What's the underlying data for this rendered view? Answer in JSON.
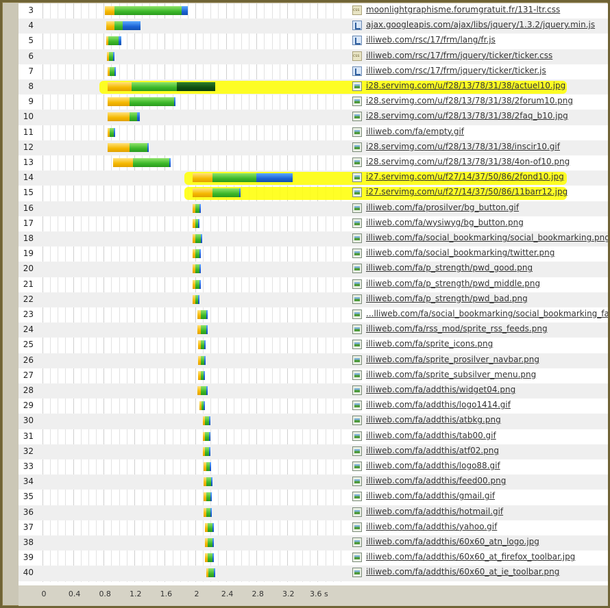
{
  "rows": [
    {
      "num": "3",
      "type": "css",
      "url": "moonlightgraphisme.forumgratuit.fr/131-ltr.css",
      "timing": [
        {
          "k": "wait",
          "s": 0.82,
          "e": 0.94
        },
        {
          "k": "recv",
          "s": 0.94,
          "e": 1.82
        },
        {
          "k": "cont",
          "s": 1.82,
          "e": 1.9
        }
      ]
    },
    {
      "num": "4",
      "type": "script",
      "url": "ajax.googleapis.com/ajax/libs/jquery/1.3.2/jquery.min.js",
      "timing": [
        {
          "k": "wait",
          "s": 0.83,
          "e": 0.94
        },
        {
          "k": "recv",
          "s": 0.94,
          "e": 1.05
        },
        {
          "k": "cont",
          "s": 1.05,
          "e": 1.28
        }
      ]
    },
    {
      "num": "5",
      "type": "script",
      "url": "illiweb.com/rsc/17/frm/lang/fr.js",
      "timing": [
        {
          "k": "wait",
          "s": 0.83,
          "e": 0.86
        },
        {
          "k": "recv",
          "s": 0.86,
          "e": 1.0
        },
        {
          "k": "cont",
          "s": 1.0,
          "e": 1.03
        }
      ]
    },
    {
      "num": "6",
      "type": "css",
      "url": "illiweb.com/rsc/17/frm/jquery/ticker/ticker.css",
      "timing": [
        {
          "k": "wait",
          "s": 0.84,
          "e": 0.87
        },
        {
          "k": "recv",
          "s": 0.87,
          "e": 0.92
        },
        {
          "k": "cont",
          "s": 0.92,
          "e": 0.93
        }
      ]
    },
    {
      "num": "7",
      "type": "script",
      "url": "illiweb.com/rsc/17/frm/jquery/ticker/ticker.js",
      "timing": [
        {
          "k": "wait",
          "s": 0.85,
          "e": 0.88
        },
        {
          "k": "recv",
          "s": 0.88,
          "e": 0.94
        },
        {
          "k": "cont",
          "s": 0.94,
          "e": 0.95
        }
      ]
    },
    {
      "num": "8",
      "type": "image",
      "url": "i28.servimg.com/u/f28/13/78/31/38/actuel10.jpg",
      "highlight": true,
      "timing": [
        {
          "k": "wait",
          "s": 0.85,
          "e": 1.17
        },
        {
          "k": "recv",
          "s": 1.17,
          "e": 1.76
        },
        {
          "k": "dark",
          "s": 1.76,
          "e": 2.26
        }
      ]
    },
    {
      "num": "9",
      "type": "image",
      "url": "i28.servimg.com/u/f28/13/78/31/38/2forum10.png",
      "timing": [
        {
          "k": "wait",
          "s": 0.85,
          "e": 1.14
        },
        {
          "k": "recv",
          "s": 1.14,
          "e": 1.72
        },
        {
          "k": "cont",
          "s": 1.72,
          "e": 1.74
        }
      ]
    },
    {
      "num": "10",
      "type": "image",
      "url": "i28.servimg.com/u/f28/13/78/31/38/2faq_b10.jpg",
      "timing": [
        {
          "k": "wait",
          "s": 0.85,
          "e": 1.14
        },
        {
          "k": "recv",
          "s": 1.14,
          "e": 1.24
        },
        {
          "k": "cont",
          "s": 1.24,
          "e": 1.27
        }
      ]
    },
    {
      "num": "11",
      "type": "image",
      "url": "illiweb.com/fa/empty.gif",
      "timing": [
        {
          "k": "wait",
          "s": 0.85,
          "e": 0.88
        },
        {
          "k": "recv",
          "s": 0.88,
          "e": 0.93
        },
        {
          "k": "cont",
          "s": 0.93,
          "e": 0.94
        }
      ]
    },
    {
      "num": "12",
      "type": "image",
      "url": "i28.servimg.com/u/f28/13/78/31/38/inscir10.gif",
      "timing": [
        {
          "k": "wait",
          "s": 0.85,
          "e": 1.14
        },
        {
          "k": "recv",
          "s": 1.14,
          "e": 1.37
        },
        {
          "k": "cont",
          "s": 1.37,
          "e": 1.39
        }
      ]
    },
    {
      "num": "13",
      "type": "image",
      "url": "i28.servimg.com/u/f28/13/78/31/38/4on-of10.png",
      "timing": [
        {
          "k": "wait",
          "s": 0.92,
          "e": 1.18
        },
        {
          "k": "recv",
          "s": 1.18,
          "e": 1.66
        },
        {
          "k": "cont",
          "s": 1.66,
          "e": 1.68
        }
      ]
    },
    {
      "num": "14",
      "type": "image",
      "url": "i27.servimg.com/u/f27/14/37/50/86/2fond10.jpg",
      "highlight": true,
      "timing": [
        {
          "k": "wait",
          "s": 1.96,
          "e": 2.22
        },
        {
          "k": "recv",
          "s": 2.22,
          "e": 2.8
        },
        {
          "k": "cont",
          "s": 2.8,
          "e": 3.27
        }
      ]
    },
    {
      "num": "15",
      "type": "image",
      "url": "i27.servimg.com/u/f27/14/37/50/86/11barr12.jpg",
      "highlight": true,
      "timing": [
        {
          "k": "wait",
          "s": 1.96,
          "e": 2.22
        },
        {
          "k": "recv",
          "s": 2.22,
          "e": 2.57
        },
        {
          "k": "cont",
          "s": 2.57,
          "e": 2.59
        }
      ]
    },
    {
      "num": "16",
      "type": "image",
      "url": "illiweb.com/fa/prosilver/bg_button.gif",
      "timing": [
        {
          "k": "wait",
          "s": 1.96,
          "e": 2.0
        },
        {
          "k": "recv",
          "s": 2.0,
          "e": 2.05
        },
        {
          "k": "cont",
          "s": 2.05,
          "e": 2.06
        }
      ]
    },
    {
      "num": "17",
      "type": "image",
      "url": "illiweb.com/fa/wysiwyg/bg_button.png",
      "timing": [
        {
          "k": "wait",
          "s": 1.96,
          "e": 2.0
        },
        {
          "k": "recv",
          "s": 2.0,
          "e": 2.04
        },
        {
          "k": "cont",
          "s": 2.04,
          "e": 2.05
        }
      ]
    },
    {
      "num": "18",
      "type": "image",
      "url": "illiweb.com/fa/social_bookmarking/social_bookmarking.png",
      "timing": [
        {
          "k": "wait",
          "s": 1.96,
          "e": 2.0
        },
        {
          "k": "recv",
          "s": 2.0,
          "e": 2.07
        },
        {
          "k": "cont",
          "s": 2.07,
          "e": 2.08
        }
      ]
    },
    {
      "num": "19",
      "type": "image",
      "url": "illiweb.com/fa/social_bookmarking/twitter.png",
      "timing": [
        {
          "k": "wait",
          "s": 1.96,
          "e": 2.0
        },
        {
          "k": "recv",
          "s": 2.0,
          "e": 2.05
        },
        {
          "k": "cont",
          "s": 2.05,
          "e": 2.06
        }
      ]
    },
    {
      "num": "20",
      "type": "image",
      "url": "illiweb.com/fa/p_strength/pwd_good.png",
      "timing": [
        {
          "k": "wait",
          "s": 1.96,
          "e": 2.0
        },
        {
          "k": "recv",
          "s": 2.0,
          "e": 2.05
        },
        {
          "k": "cont",
          "s": 2.05,
          "e": 2.06
        }
      ]
    },
    {
      "num": "21",
      "type": "image",
      "url": "illiweb.com/fa/p_strength/pwd_middle.png",
      "timing": [
        {
          "k": "wait",
          "s": 1.96,
          "e": 2.0
        },
        {
          "k": "recv",
          "s": 2.0,
          "e": 2.05
        },
        {
          "k": "cont",
          "s": 2.05,
          "e": 2.06
        }
      ]
    },
    {
      "num": "22",
      "type": "image",
      "url": "illiweb.com/fa/p_strength/pwd_bad.png",
      "timing": [
        {
          "k": "wait",
          "s": 1.96,
          "e": 2.0
        },
        {
          "k": "recv",
          "s": 2.0,
          "e": 2.04
        },
        {
          "k": "cont",
          "s": 2.04,
          "e": 2.05
        }
      ]
    },
    {
      "num": "23",
      "type": "image",
      "url": "...lliweb.com/fa/social_bookmarking/social_bookmarking_fa.png",
      "timing": [
        {
          "k": "wait",
          "s": 2.03,
          "e": 2.07
        },
        {
          "k": "recv",
          "s": 2.07,
          "e": 2.14
        },
        {
          "k": "cont",
          "s": 2.14,
          "e": 2.15
        }
      ]
    },
    {
      "num": "24",
      "type": "image",
      "url": "illiweb.com/fa/rss_mod/sprite_rss_feeds.png",
      "timing": [
        {
          "k": "wait",
          "s": 2.03,
          "e": 2.07
        },
        {
          "k": "recv",
          "s": 2.07,
          "e": 2.14
        },
        {
          "k": "cont",
          "s": 2.14,
          "e": 2.15
        }
      ]
    },
    {
      "num": "25",
      "type": "image",
      "url": "illiweb.com/fa/sprite_icons.png",
      "timing": [
        {
          "k": "wait",
          "s": 2.04,
          "e": 2.07
        },
        {
          "k": "recv",
          "s": 2.07,
          "e": 2.12
        },
        {
          "k": "cont",
          "s": 2.12,
          "e": 2.13
        }
      ]
    },
    {
      "num": "26",
      "type": "image",
      "url": "illiweb.com/fa/sprite_prosilver_navbar.png",
      "timing": [
        {
          "k": "wait",
          "s": 2.04,
          "e": 2.07
        },
        {
          "k": "recv",
          "s": 2.07,
          "e": 2.12
        },
        {
          "k": "cont",
          "s": 2.12,
          "e": 2.13
        }
      ]
    },
    {
      "num": "27",
      "type": "image",
      "url": "illiweb.com/fa/sprite_subsilver_menu.png",
      "timing": [
        {
          "k": "wait",
          "s": 2.04,
          "e": 2.07
        },
        {
          "k": "recv",
          "s": 2.07,
          "e": 2.11
        },
        {
          "k": "cont",
          "s": 2.11,
          "e": 2.12
        }
      ]
    },
    {
      "num": "28",
      "type": "image",
      "url": "illiweb.com/fa/addthis/widget04.png",
      "timing": [
        {
          "k": "wait",
          "s": 2.03,
          "e": 2.07
        },
        {
          "k": "recv",
          "s": 2.07,
          "e": 2.14
        },
        {
          "k": "cont",
          "s": 2.14,
          "e": 2.15
        }
      ]
    },
    {
      "num": "29",
      "type": "image",
      "url": "illiweb.com/fa/addthis/logo1414.gif",
      "timing": [
        {
          "k": "wait",
          "s": 2.05,
          "e": 2.08
        },
        {
          "k": "recv",
          "s": 2.08,
          "e": 2.11
        },
        {
          "k": "cont",
          "s": 2.11,
          "e": 2.12
        }
      ]
    },
    {
      "num": "30",
      "type": "image",
      "url": "illiweb.com/fa/addthis/atbkg.png",
      "timing": [
        {
          "k": "wait",
          "s": 2.1,
          "e": 2.13
        },
        {
          "k": "recv",
          "s": 2.13,
          "e": 2.18
        },
        {
          "k": "cont",
          "s": 2.18,
          "e": 2.19
        }
      ]
    },
    {
      "num": "31",
      "type": "image",
      "url": "illiweb.com/fa/addthis/tab00.gif",
      "timing": [
        {
          "k": "wait",
          "s": 2.1,
          "e": 2.13
        },
        {
          "k": "recv",
          "s": 2.13,
          "e": 2.18
        },
        {
          "k": "cont",
          "s": 2.18,
          "e": 2.19
        }
      ]
    },
    {
      "num": "32",
      "type": "image",
      "url": "illiweb.com/fa/addthis/atf02.png",
      "timing": [
        {
          "k": "wait",
          "s": 2.1,
          "e": 2.13
        },
        {
          "k": "recv",
          "s": 2.13,
          "e": 2.18
        },
        {
          "k": "cont",
          "s": 2.18,
          "e": 2.19
        }
      ]
    },
    {
      "num": "33",
      "type": "image",
      "url": "illiweb.com/fa/addthis/logo88.gif",
      "timing": [
        {
          "k": "wait",
          "s": 2.11,
          "e": 2.14
        },
        {
          "k": "recv",
          "s": 2.14,
          "e": 2.19
        },
        {
          "k": "cont",
          "s": 2.19,
          "e": 2.2
        }
      ]
    },
    {
      "num": "34",
      "type": "image",
      "url": "illiweb.com/fa/addthis/feed00.png",
      "timing": [
        {
          "k": "wait",
          "s": 2.11,
          "e": 2.14
        },
        {
          "k": "recv",
          "s": 2.14,
          "e": 2.21
        },
        {
          "k": "cont",
          "s": 2.21,
          "e": 2.22
        }
      ]
    },
    {
      "num": "35",
      "type": "image",
      "url": "illiweb.com/fa/addthis/gmail.gif",
      "timing": [
        {
          "k": "wait",
          "s": 2.11,
          "e": 2.14
        },
        {
          "k": "recv",
          "s": 2.14,
          "e": 2.2
        },
        {
          "k": "cont",
          "s": 2.2,
          "e": 2.21
        }
      ]
    },
    {
      "num": "36",
      "type": "image",
      "url": "illiweb.com/fa/addthis/hotmail.gif",
      "timing": [
        {
          "k": "wait",
          "s": 2.11,
          "e": 2.14
        },
        {
          "k": "recv",
          "s": 2.14,
          "e": 2.2
        },
        {
          "k": "cont",
          "s": 2.2,
          "e": 2.21
        }
      ]
    },
    {
      "num": "37",
      "type": "image",
      "url": "illiweb.com/fa/addthis/yahoo.gif",
      "timing": [
        {
          "k": "wait",
          "s": 2.13,
          "e": 2.16
        },
        {
          "k": "recv",
          "s": 2.16,
          "e": 2.22
        },
        {
          "k": "cont",
          "s": 2.22,
          "e": 2.23
        }
      ]
    },
    {
      "num": "38",
      "type": "image",
      "url": "illiweb.com/fa/addthis/60x60_atn_logo.jpg",
      "timing": [
        {
          "k": "wait",
          "s": 2.13,
          "e": 2.16
        },
        {
          "k": "recv",
          "s": 2.16,
          "e": 2.22
        },
        {
          "k": "cont",
          "s": 2.22,
          "e": 2.23
        }
      ]
    },
    {
      "num": "39",
      "type": "image",
      "url": "illiweb.com/fa/addthis/60x60_at_firefox_toolbar.jpg",
      "timing": [
        {
          "k": "wait",
          "s": 2.13,
          "e": 2.16
        },
        {
          "k": "recv",
          "s": 2.16,
          "e": 2.22
        },
        {
          "k": "cont",
          "s": 2.22,
          "e": 2.23
        }
      ]
    },
    {
      "num": "40",
      "type": "image",
      "url": "illiweb.com/fa/addthis/60x60_at_ie_toolbar.png",
      "timing": [
        {
          "k": "wait",
          "s": 2.14,
          "e": 2.17
        },
        {
          "k": "recv",
          "s": 2.17,
          "e": 2.24
        },
        {
          "k": "cont",
          "s": 2.24,
          "e": 2.25
        }
      ]
    }
  ],
  "axis": {
    "ticks": [
      {
        "v": 0,
        "label": "0"
      },
      {
        "v": 0.4,
        "label": "0.4"
      },
      {
        "v": 0.8,
        "label": "0.8"
      },
      {
        "v": 1.2,
        "label": "1.2"
      },
      {
        "v": 1.6,
        "label": "1.6"
      },
      {
        "v": 2.0,
        "label": "2"
      },
      {
        "v": 2.4,
        "label": "2.4"
      },
      {
        "v": 2.8,
        "label": "2.8"
      },
      {
        "v": 3.2,
        "label": "3.2"
      },
      {
        "v": 3.6,
        "label": "3.6 s"
      }
    ],
    "max_seconds": 3.9
  },
  "colors": {
    "wait": "#f5b800",
    "receive": "#3cb82a",
    "content": "#1b63d6",
    "highlight": "#ffff00"
  }
}
